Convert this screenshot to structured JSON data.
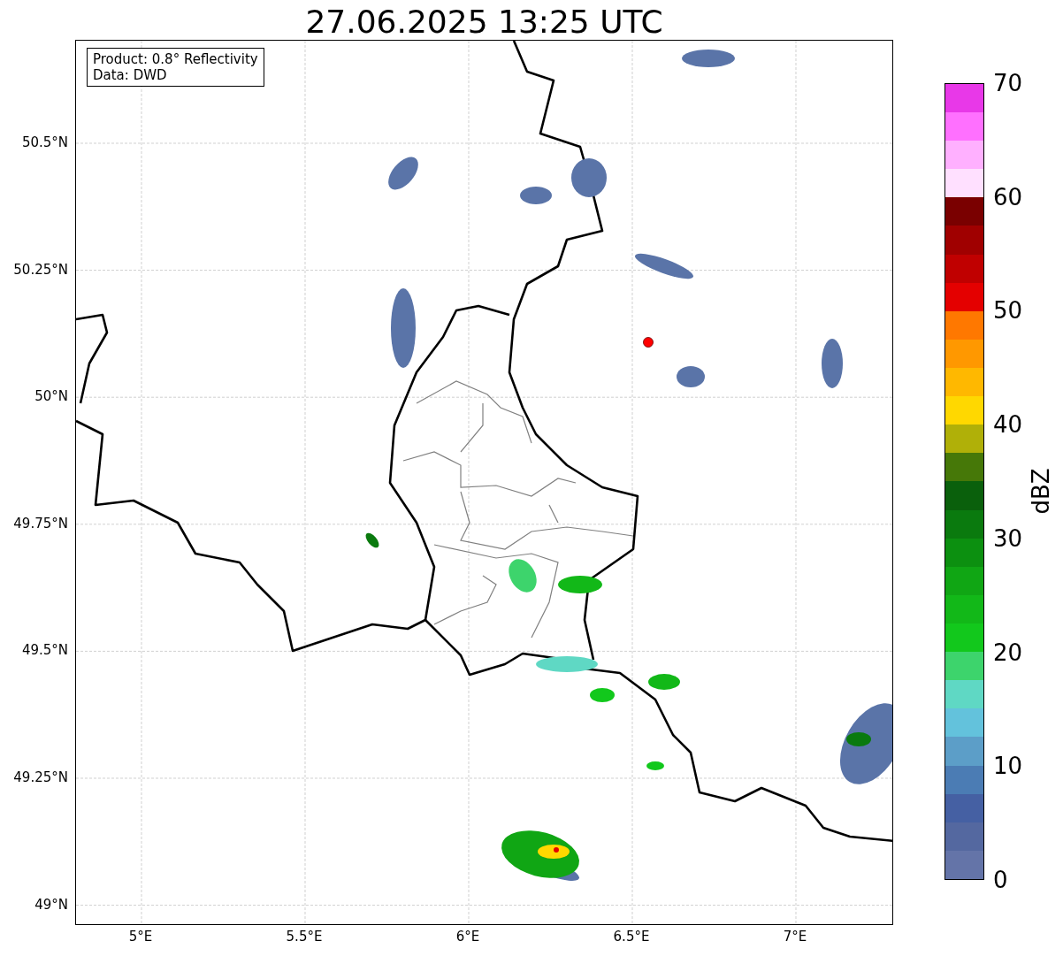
{
  "title": "27.06.2025 13:25 UTC",
  "map": {
    "info_box": [
      "Product: 0.8° Reflectivity",
      "Data: DWD"
    ],
    "y_ticks": [
      "50.5°N",
      "50.25°N",
      "50°N",
      "49.75°N",
      "49.5°N",
      "49.25°N",
      "49°N"
    ],
    "x_ticks": [
      "5°E",
      "5.5°E",
      "6°E",
      "6.5°E",
      "7°E"
    ]
  },
  "colorbar": {
    "label": "dBZ",
    "ticks": [
      "70",
      "60",
      "50",
      "40",
      "30",
      "20",
      "10",
      "0"
    ],
    "bands": [
      {
        "color": "#6474a8"
      },
      {
        "color": "#5468a0"
      },
      {
        "color": "#4560a3"
      },
      {
        "color": "#4b7cb4"
      },
      {
        "color": "#5c9ec8"
      },
      {
        "color": "#63c2dc"
      },
      {
        "color": "#5fd8c4"
      },
      {
        "color": "#3dd46c"
      },
      {
        "color": "#12c81c"
      },
      {
        "color": "#12b818"
      },
      {
        "color": "#10a614"
      },
      {
        "color": "#0c9010"
      },
      {
        "color": "#0a7a0e"
      },
      {
        "color": "#0a600c"
      },
      {
        "color": "#467808"
      },
      {
        "color": "#b0b008"
      },
      {
        "color": "#ffd800"
      },
      {
        "color": "#ffb800"
      },
      {
        "color": "#ff9800"
      },
      {
        "color": "#ff7800"
      },
      {
        "color": "#e40000"
      },
      {
        "color": "#c00000"
      },
      {
        "color": "#a00000"
      },
      {
        "color": "#7a0000"
      },
      {
        "color": "#ffe0ff"
      },
      {
        "color": "#ffb0ff"
      },
      {
        "color": "#ff70ff"
      },
      {
        "color": "#e838e8"
      }
    ]
  }
}
